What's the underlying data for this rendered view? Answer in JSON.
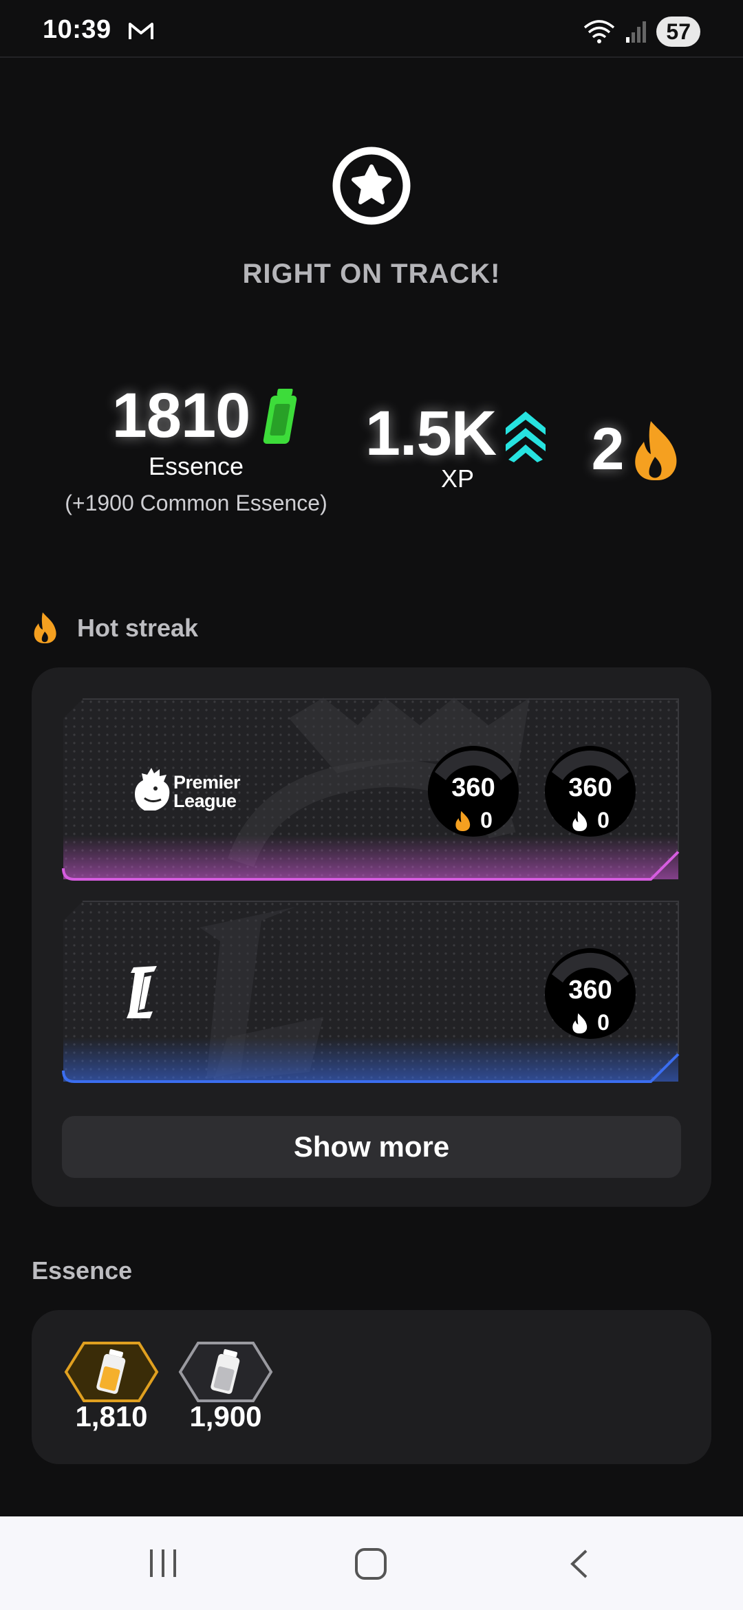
{
  "status_bar": {
    "time": "10:39",
    "battery": "57",
    "icons": [
      "gmail-icon",
      "wifi-icon",
      "signal-icon"
    ]
  },
  "hero": {
    "icon": "star-badge-icon",
    "title": "RIGHT ON TRACK!"
  },
  "stats": {
    "essence_value": "1810",
    "essence_label": "Essence",
    "essence_sub": "(+1900 Common Essence)",
    "xp_value": "1.5K",
    "xp_label": "XP",
    "streak_value": "2"
  },
  "hot_streak": {
    "title": "Hot streak",
    "leagues": [
      {
        "name": "Premier League",
        "accent": "#d65ce0",
        "badges": [
          {
            "value": "360",
            "count": "0",
            "flame": "orange"
          },
          {
            "value": "360",
            "count": "0",
            "flame": "white"
          }
        ]
      },
      {
        "name": "LaLiga",
        "accent": "#3b6ef0",
        "badges": [
          {
            "value": "360",
            "count": "0",
            "flame": "white"
          }
        ]
      }
    ],
    "show_more": "Show more"
  },
  "essence_section": {
    "title": "Essence",
    "items": [
      {
        "value": "1,810",
        "type": "gold"
      },
      {
        "value": "1,900",
        "type": "silver"
      }
    ]
  },
  "colors": {
    "background": "#0f0f10",
    "panel": "#1e1e20",
    "essence_green": "#3ddc3a",
    "xp_cyan": "#27e3e0",
    "flame_orange": "#f5a020"
  }
}
